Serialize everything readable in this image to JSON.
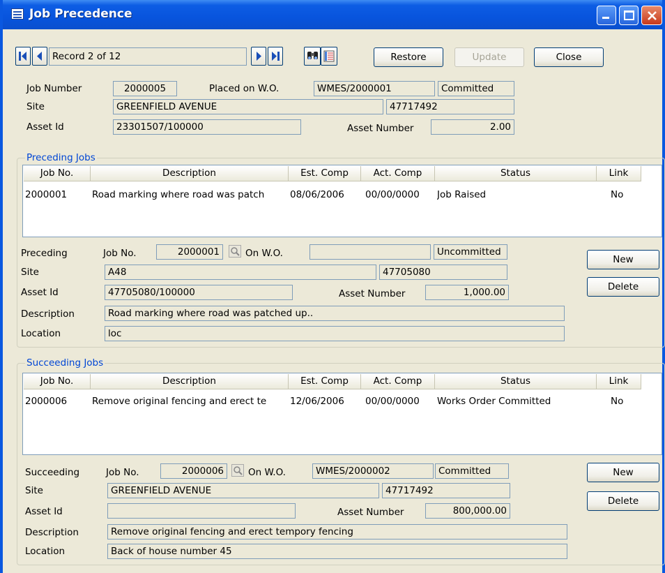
{
  "window": {
    "title": "Job Precedence"
  },
  "nav": {
    "record_text": "Record 2 of 12"
  },
  "toolbar": {
    "restore": "Restore",
    "update": "Update",
    "close": "Close"
  },
  "header": {
    "job_number_label": "Job Number",
    "job_number": "2000005",
    "placed_label": "Placed on W.O.",
    "wo": "WMES/2000001",
    "wo_status": "Committed",
    "site_label": "Site",
    "site": "GREENFIELD AVENUE",
    "site_code": "47717492",
    "asset_id_label": "Asset Id",
    "asset_id": "23301507/100000",
    "asset_number_label": "Asset Number",
    "asset_number": "2.00"
  },
  "preceding": {
    "group_title": "Preceding Jobs",
    "columns": [
      "Job No.",
      "Description",
      "Est. Comp",
      "Act. Comp",
      "Status",
      "Link"
    ],
    "rows": [
      {
        "job_no": "2000001",
        "description": "Road marking where road was patch",
        "est": "08/06/2006",
        "act": "00/00/0000",
        "status": "Job Raised",
        "link": "No"
      }
    ],
    "detail": {
      "title_label": "Preceding",
      "job_no_label": "Job No.",
      "job_no": "2000001",
      "on_wo_label": "On W.O.",
      "wo": "",
      "wo_status": "Uncommitted",
      "site_label": "Site",
      "site": "A48",
      "site_code": "47705080",
      "asset_id_label": "Asset Id",
      "asset_id": "47705080/100000",
      "asset_number_label": "Asset Number",
      "asset_number": "1,000.00",
      "description_label": "Description",
      "description": "Road marking where road was patched up..",
      "location_label": "Location",
      "location": "loc"
    },
    "new_label": "New",
    "delete_label": "Delete"
  },
  "succeeding": {
    "group_title": "Succeeding Jobs",
    "columns": [
      "Job No.",
      "Description",
      "Est. Comp",
      "Act. Comp",
      "Status",
      "Link"
    ],
    "rows": [
      {
        "job_no": "2000006",
        "description": "Remove original fencing and erect te",
        "est": "12/06/2006",
        "act": "00/00/0000",
        "status": "Works Order Committed",
        "link": "No"
      }
    ],
    "detail": {
      "title_label": "Succeeding",
      "job_no_label": "Job No.",
      "job_no": "2000006",
      "on_wo_label": "On W.O.",
      "wo": "WMES/2000002",
      "wo_status": "Committed",
      "site_label": "Site",
      "site": "GREENFIELD AVENUE",
      "site_code": "47717492",
      "asset_id_label": "Asset Id",
      "asset_id": "",
      "asset_number_label": "Asset Number",
      "asset_number": "800,000.00",
      "description_label": "Description",
      "description": "Remove original fencing and erect tempory fencing",
      "location_label": "Location",
      "location": "Back of house number 45"
    },
    "new_label": "New",
    "delete_label": "Delete"
  },
  "colors": {
    "titlebar": "#0854dd",
    "dialog_bg": "#ece9d8",
    "group_title": "#0046d5",
    "field_border": "#7f9db9"
  }
}
